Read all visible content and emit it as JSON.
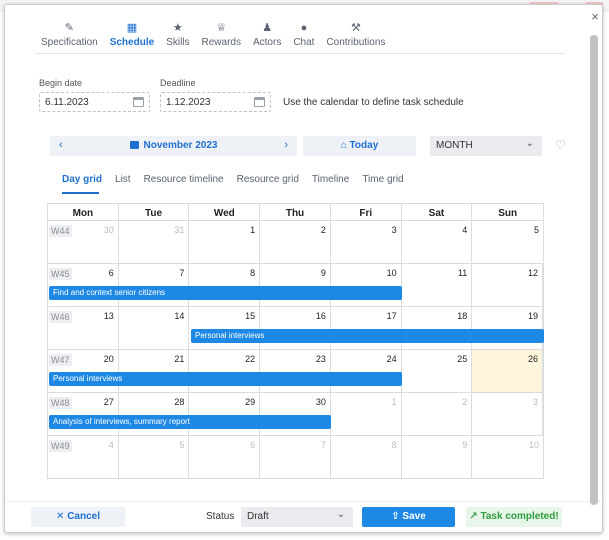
{
  "tabs": [
    {
      "label": "Specification",
      "icon": "pencil-icon",
      "glyph": "✎"
    },
    {
      "label": "Schedule",
      "icon": "calendar-icon",
      "glyph": "▦"
    },
    {
      "label": "Skills",
      "icon": "star-icon",
      "glyph": "★"
    },
    {
      "label": "Rewards",
      "icon": "medal-icon",
      "glyph": "♕"
    },
    {
      "label": "Actors",
      "icon": "users-icon",
      "glyph": "♟"
    },
    {
      "label": "Chat",
      "icon": "chat-icon",
      "glyph": "●"
    },
    {
      "label": "Contributions",
      "icon": "hammer-icon",
      "glyph": "⚒"
    }
  ],
  "active_tab": "Schedule",
  "begin": {
    "label": "Begin date",
    "value": "6.11.2023"
  },
  "deadline": {
    "label": "Deadline",
    "value": "1.12.2023"
  },
  "hint": "Use the calendar to define task schedule",
  "nav": {
    "prev": "‹",
    "next": "›",
    "month": "November 2023",
    "today": "Today",
    "view": "MONTH",
    "chevron": "⌄",
    "heart": "♡"
  },
  "subtabs": [
    "Day grid",
    "List",
    "Resource timeline",
    "Resource grid",
    "Timeline",
    "Time grid"
  ],
  "active_subtab": "Day grid",
  "days": [
    "Mon",
    "Tue",
    "Wed",
    "Thu",
    "Fri",
    "Sat",
    "Sun"
  ],
  "weeks": [
    {
      "label": "W44",
      "dates": [
        {
          "n": "30",
          "other": true
        },
        {
          "n": "31",
          "other": true
        },
        {
          "n": "1"
        },
        {
          "n": "2"
        },
        {
          "n": "3"
        },
        {
          "n": "4"
        },
        {
          "n": "5"
        }
      ]
    },
    {
      "label": "W45",
      "dates": [
        {
          "n": "6"
        },
        {
          "n": "7"
        },
        {
          "n": "8"
        },
        {
          "n": "9"
        },
        {
          "n": "10"
        },
        {
          "n": "11"
        },
        {
          "n": "12"
        }
      ]
    },
    {
      "label": "W46",
      "dates": [
        {
          "n": "13"
        },
        {
          "n": "14"
        },
        {
          "n": "15"
        },
        {
          "n": "16"
        },
        {
          "n": "17"
        },
        {
          "n": "18"
        },
        {
          "n": "19"
        }
      ]
    },
    {
      "label": "W47",
      "dates": [
        {
          "n": "20"
        },
        {
          "n": "21"
        },
        {
          "n": "22"
        },
        {
          "n": "23"
        },
        {
          "n": "24"
        },
        {
          "n": "25"
        },
        {
          "n": "26",
          "today": true
        }
      ]
    },
    {
      "label": "W48",
      "dates": [
        {
          "n": "27"
        },
        {
          "n": "28"
        },
        {
          "n": "29"
        },
        {
          "n": "30"
        },
        {
          "n": "1",
          "other": true
        },
        {
          "n": "2",
          "other": true
        },
        {
          "n": "3",
          "other": true
        }
      ]
    },
    {
      "label": "W49",
      "dates": [
        {
          "n": "4",
          "other": true
        },
        {
          "n": "5",
          "other": true
        },
        {
          "n": "6",
          "other": true
        },
        {
          "n": "7",
          "other": true
        },
        {
          "n": "8",
          "other": true
        },
        {
          "n": "9",
          "other": true
        },
        {
          "n": "10",
          "other": true
        }
      ]
    }
  ],
  "events": [
    {
      "title": "Find and context senior citizens",
      "week": 1,
      "start": 0,
      "end": 4
    },
    {
      "title": "Personal interviews",
      "week": 2,
      "start": 2,
      "end": 6
    },
    {
      "title": "Personal interviews",
      "week": 3,
      "start": 0,
      "end": 4
    },
    {
      "title": "Analysis of interviews, summary report",
      "week": 4,
      "start": 0,
      "end": 3
    }
  ],
  "footer": {
    "cancel": "Cancel",
    "cancel_glyph": "✕",
    "status_label": "Status",
    "status_value": "Draft",
    "save": "Save",
    "save_glyph": "⇪",
    "completed": "Task completed!",
    "completed_glyph": "↗"
  },
  "colors": {
    "accent": "#1f6fd1",
    "event": "#1e88e5",
    "today_bg": "#fdf6dc",
    "success": "#2e9e3e"
  }
}
